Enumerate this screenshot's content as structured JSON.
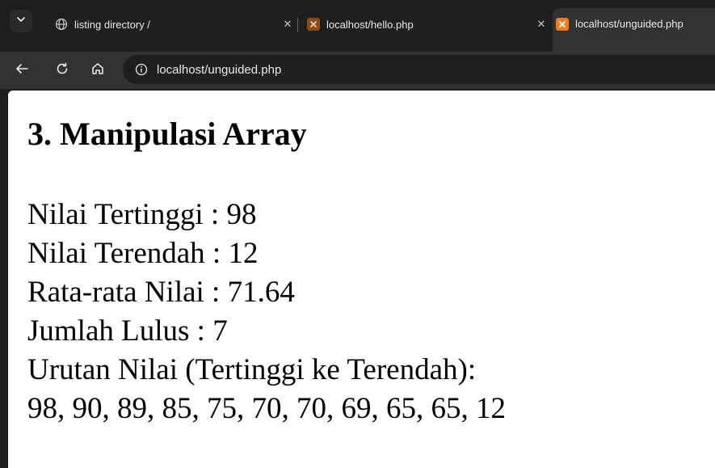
{
  "tabs": [
    {
      "label": "listing directory /",
      "icon": "globe-icon",
      "active": false
    },
    {
      "label": "localhost/hello.php",
      "icon": "xampp-icon",
      "active": false
    },
    {
      "label": "localhost/unguided.php",
      "icon": "xampp-icon",
      "active": true
    }
  ],
  "toolbar": {
    "url": "localhost/unguided.php"
  },
  "page": {
    "heading": "3. Manipulasi Array",
    "lines": [
      "Nilai Tertinggi : 98",
      "Nilai Terendah : 12",
      "Rata-rata Nilai : 71.64",
      "Jumlah Lulus : 7",
      "Urutan Nilai (Tertinggi ke Terendah):",
      "98, 90, 89, 85, 75, 70, 70, 69, 65, 65, 12"
    ]
  },
  "colors": {
    "chrome_dark": "#1f1f1f",
    "toolbar": "#323232",
    "xampp_orange": "#f07b1f",
    "page_bg": "#ffffff"
  }
}
